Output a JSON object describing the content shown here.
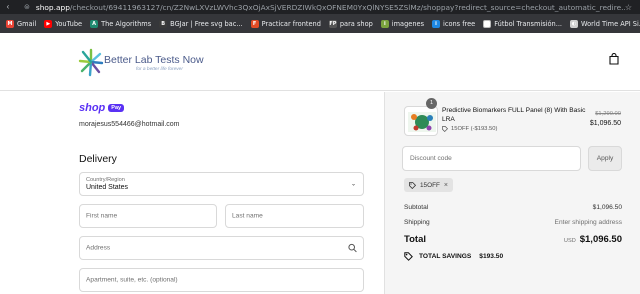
{
  "browser": {
    "url_host": "shop.app",
    "url_path": "/checkout/69411963127/cn/Z2NwLXVzLWVhc3QxOjAxSjVERDZIWkQxOFNEM0YxQlNYSE5ZSlMz/shoppay?redirect_source=checkout_automatic_redire..."
  },
  "bookmarks": [
    {
      "label": "Gmail",
      "icon": "gmail-icon",
      "color": "#ea4335",
      "glyph": "M"
    },
    {
      "label": "YouTube",
      "icon": "youtube-icon",
      "color": "#ff0000",
      "glyph": "▶"
    },
    {
      "label": "The Algorithms",
      "icon": "algorithms-icon",
      "color": "#1f8a70",
      "glyph": "A"
    },
    {
      "label": "BGJar | Free svg bac...",
      "icon": "bgjar-icon",
      "color": "#3a3a3a",
      "glyph": "B"
    },
    {
      "label": "Practicar frontend",
      "icon": "frontend-icon",
      "color": "#e34c26",
      "glyph": "F"
    },
    {
      "label": "para shop",
      "icon": "shop-bookmark-icon",
      "color": "#555",
      "glyph": "FP"
    },
    {
      "label": "imagenes",
      "icon": "images-icon",
      "color": "#7aa23e",
      "glyph": "i"
    },
    {
      "label": "icons free",
      "icon": "icons-free-icon",
      "color": "#1e88e5",
      "glyph": "i"
    },
    {
      "label": "Fútbol Transmisión...",
      "icon": "football-icon",
      "color": "#ffffff",
      "glyph": ""
    },
    {
      "label": "World Time API Si...",
      "icon": "worldtime-icon",
      "color": "#cfcfcf",
      "glyph": "◐"
    }
  ],
  "header": {
    "logo_title": "Better Lab Tests Now",
    "logo_tagline": "for a better life forever"
  },
  "account": {
    "shop_word": "shop",
    "pay_word": "Pay",
    "email": "morajesus554466@hotmail.com"
  },
  "delivery": {
    "title": "Delivery",
    "country_label": "Country/Region",
    "country_value": "United States",
    "first_name_placeholder": "First name",
    "last_name_placeholder": "Last name",
    "address_placeholder": "Address",
    "apartment_placeholder": "Apartment, suite, etc. (optional)"
  },
  "summary": {
    "quantity": "1",
    "product_name": "Predictive Biomarkers FULL Panel (8) With Basic LRA",
    "discount_line": "15OFF (-$193.50)",
    "price_old": "$1,290.00",
    "price_new": "$1,096.50",
    "discount_placeholder": "Discount code",
    "apply_label": "Apply",
    "tag_code": "15OFF",
    "subtotal_label": "Subtotal",
    "subtotal_value": "$1,096.50",
    "shipping_label": "Shipping",
    "shipping_value": "Enter shipping address",
    "total_label": "Total",
    "total_currency": "USD",
    "total_value": "$1,096.50",
    "savings_label": "TOTAL SAVINGS",
    "savings_value": "$193.50"
  }
}
